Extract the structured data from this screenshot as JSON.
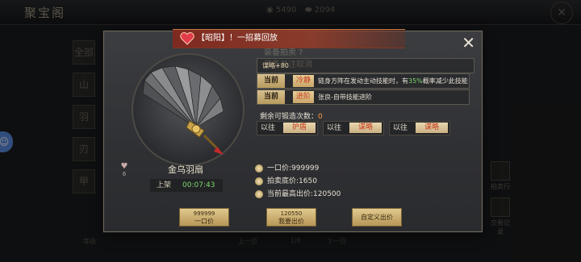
{
  "background": {
    "title": "聚宝阁",
    "currency": [
      {
        "icon": "gold-coin-icon",
        "value": "5490"
      },
      {
        "icon": "ingot-icon",
        "value": "2094"
      }
    ],
    "left_tabs": [
      "全部",
      "山",
      "羽",
      "刃",
      "甲"
    ],
    "right_items": [
      "拍卖行",
      "交易记录"
    ],
    "bottom": {
      "sort_label": "等级",
      "prev": "上一页",
      "page": "1/8",
      "next": "下一页"
    }
  },
  "notice": {
    "text": "【昭阳】！一招募回放"
  },
  "ghost_text": {
    "line1": "装备拍卖  ?",
    "line2": "装备关注取消"
  },
  "item": {
    "name": "金乌羽扇",
    "listing_label": "上架",
    "listing_time": "00:07:43",
    "favorite_count": "6",
    "attribute": "谋略+80",
    "skills": [
      {
        "label": "当前",
        "tag": "冷静",
        "desc_pre": "链身方阵在发动主动技能时，有",
        "desc_hi": "35%",
        "desc_post": "概率减少此技能"
      },
      {
        "label": "当前",
        "tag": "进阶",
        "desc_pre": "张良-自带技能进阶",
        "desc_hi": "",
        "desc_post": ""
      }
    ],
    "remaining_label": "剩余可锻造次数：",
    "remaining_value": "0",
    "gems": [
      {
        "label": "以往",
        "tag": "护盾"
      },
      {
        "label": "以往",
        "tag": "谋略"
      },
      {
        "label": "以往",
        "tag": "谋略"
      }
    ],
    "prices": {
      "buyout": "一口价:999999",
      "starting": "拍卖底价:1650",
      "highest": "当前最高出价:120500"
    }
  },
  "buttons": {
    "buyout": {
      "amount": "999999",
      "label": "一口价"
    },
    "bid": {
      "amount": "120550",
      "label": "我要出价"
    },
    "custom": {
      "label": "自定义出价"
    }
  },
  "colors": {
    "accent": "#d7c08f",
    "notice": "#8c2e20",
    "highlight": "#7fd76e"
  }
}
